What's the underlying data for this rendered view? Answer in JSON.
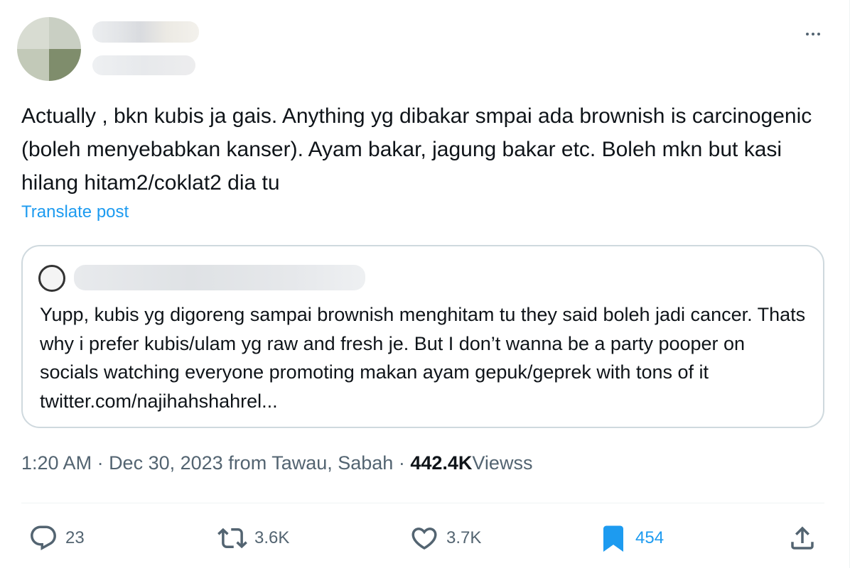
{
  "post": {
    "text": "Actually , bkn kubis ja gais. Anything yg dibakar smpai ada brownish is carcinogenic (boleh menyebabkan kanser). Ayam bakar, jagung bakar etc. Boleh mkn but kasi hilang hitam2/coklat2 dia tu",
    "translate_label": "Translate post"
  },
  "quote": {
    "text": "Yupp, kubis yg digoreng sampai brownish menghitam tu they said boleh jadi cancer. Thats why i prefer kubis/ulam yg raw and fresh je. But I don’t wanna be a party pooper on socials watching everyone promoting makan ayam gepuk/geprek with tons of it twitter.com/najihahshahrel..."
  },
  "meta": {
    "time": "1:20 AM",
    "sep1": " · ",
    "date": "Dec 30, 2023",
    "location": " from Tawau, Sabah",
    "sep2": " · ",
    "views_count": "442.4K",
    "views_label": "Viewss"
  },
  "actions": {
    "replies": "23",
    "reposts": "3.6K",
    "likes": "3.7K",
    "bookmarks": "454"
  },
  "icons": {
    "reply": "reply-icon",
    "repost": "repost-icon",
    "like": "heart-icon",
    "bookmark": "bookmark-icon",
    "share": "share-icon",
    "more": "more-icon"
  },
  "colors": {
    "accent": "#1d9bf0",
    "text": "#0f1419",
    "secondary": "#536471"
  }
}
